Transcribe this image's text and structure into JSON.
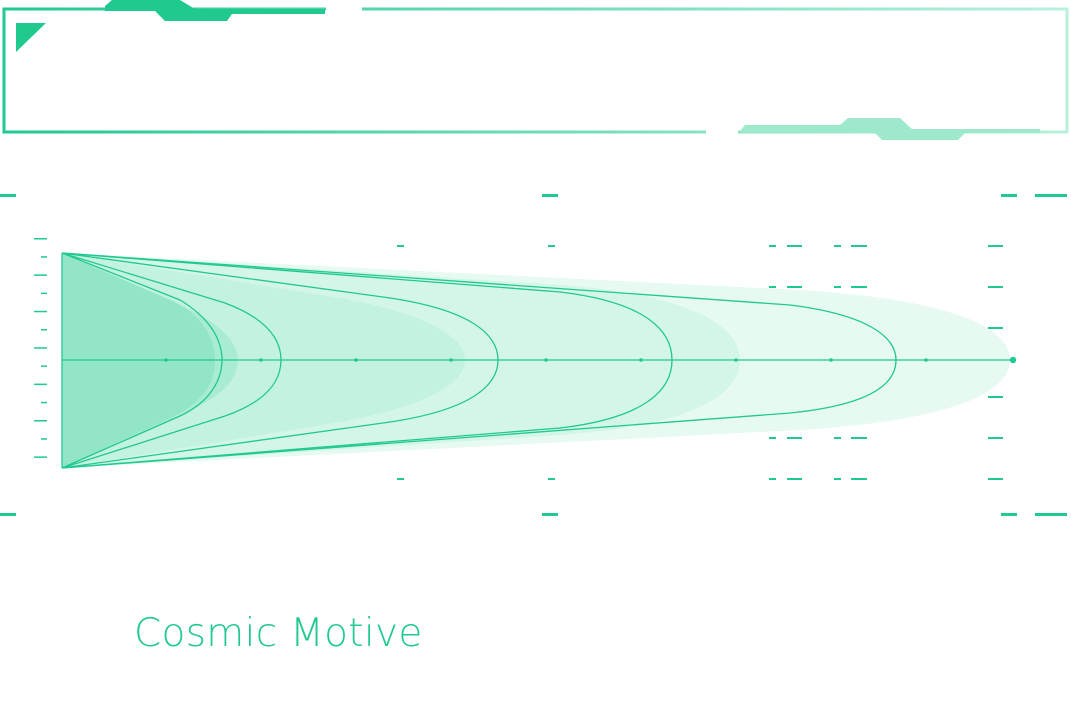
{
  "brand": {
    "name": "Cosmic Motive"
  },
  "colors": {
    "accent": "#20c98e",
    "accent_light": "#9ee9cc",
    "fill_dark": "#92e6c6",
    "fill_mid": "#b5efdb",
    "fill_light": "#d3f6e8",
    "fill_faint": "#e6faf1"
  },
  "graphic": {
    "type": "decorative-tech-frame",
    "motif": "nested-cone-shapes"
  }
}
